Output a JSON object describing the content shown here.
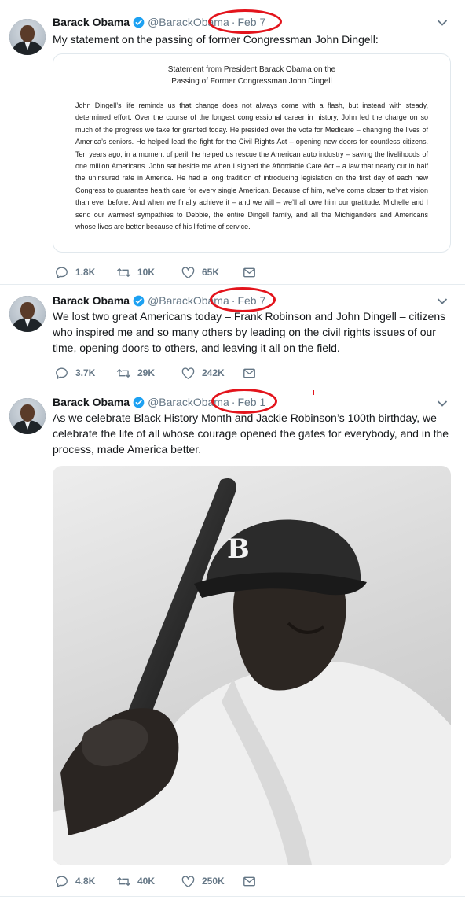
{
  "tweets": [
    {
      "name": "Barack Obama",
      "handle": "@BarackObama",
      "date": "Feb 7",
      "text": "My statement on the passing of former Congressman John Dingell:",
      "attachment": {
        "title_line1": "Statement from President Barack Obama on the",
        "title_line2": "Passing of Former Congressman John Dingell",
        "body": "John Dingell’s life reminds us that change does not always come with a flash, but instead with steady, determined effort. Over the course of the longest congressional career in history, John led the charge on so much of the progress we take for granted today. He presided over the vote for Medicare – changing the lives of America’s seniors. He helped lead the fight for the Civil Rights Act – opening new doors for countless citizens. Ten years ago, in a moment of peril, he helped us rescue the American auto industry – saving the livelihoods of one million Americans. John sat beside me when I signed the Affordable Care Act – a law that nearly cut in half the uninsured rate in America. He had a long tradition of introducing legislation on the first day of each new Congress to guarantee health care for every single American. Because of him, we’ve come closer to that vision than ever before. And when we finally achieve it – and we will – we’ll all owe him our gratitude. Michelle and I send our warmest sympathies to Debbie, the entire Dingell family, and all the Michiganders and Americans whose lives are better because of his lifetime of service."
      },
      "replies": "1.8K",
      "retweets": "10K",
      "likes": "65K"
    },
    {
      "name": "Barack Obama",
      "handle": "@BarackObama",
      "date": "Feb 7",
      "text": "We lost two great Americans today – Frank Robinson and John Dingell – citizens who inspired me and so many others by leading on the civil rights issues of our time, opening doors to others, and leaving it all on the field.",
      "replies": "3.7K",
      "retweets": "29K",
      "likes": "242K"
    },
    {
      "name": "Barack Obama",
      "handle": "@BarackObama",
      "date": "Feb 1",
      "text": "As we celebrate Black History Month and Jackie Robinson’s 100th birthday, we celebrate the life of all whose courage opened the gates for everybody, and in the process, made America better.",
      "photo_cap_letter": "B",
      "replies": "4.8K",
      "retweets": "40K",
      "likes": "250K"
    }
  ],
  "icons": {
    "reply": "reply-icon",
    "retweet": "retweet-icon",
    "like": "heart-icon",
    "dm": "envelope-icon",
    "more": "chevron-down-icon",
    "verified": "verified-badge-icon"
  },
  "colors": {
    "verified": "#1da1f2",
    "secondary_text": "#657786",
    "annotation_circle": "#e3141c"
  }
}
